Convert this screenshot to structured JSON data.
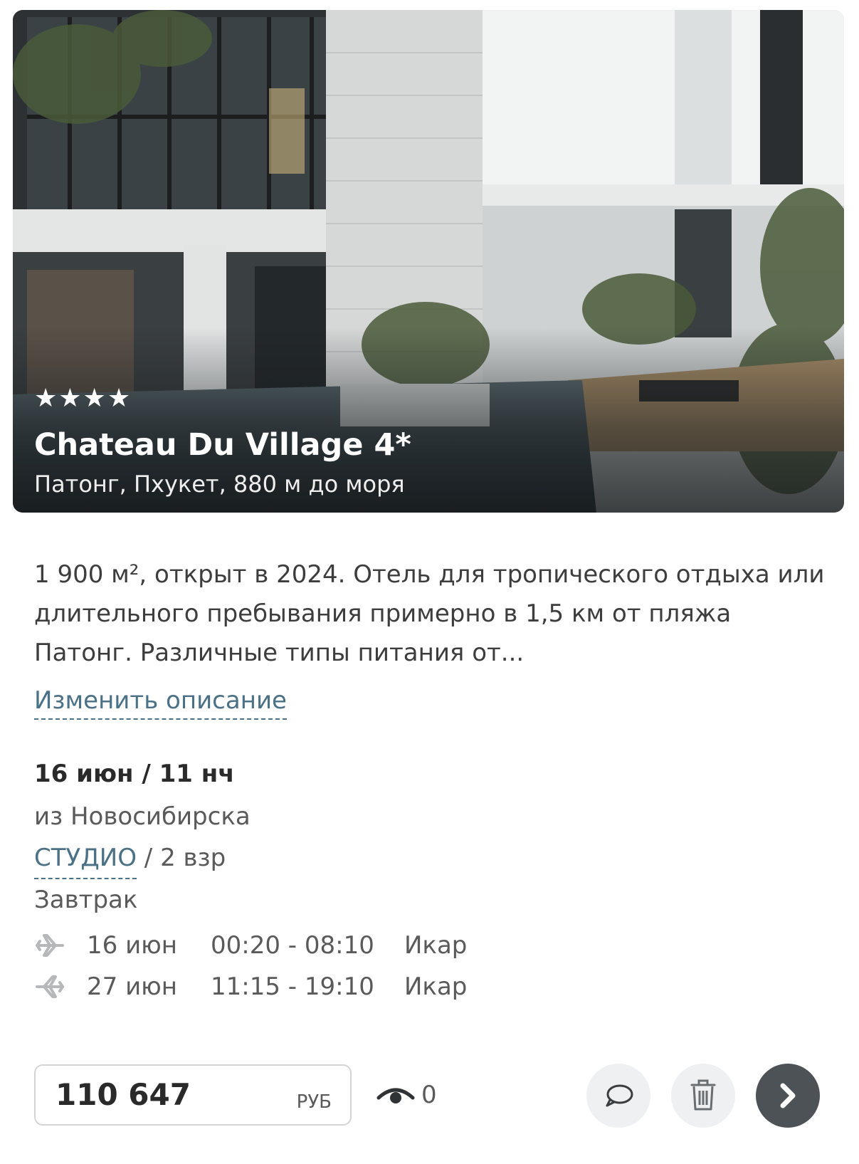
{
  "hotel": {
    "stars": "★★★★",
    "name": "Chateau Du Village 4*",
    "location": "Патонг, Пхукет, 880 м до моря"
  },
  "description": {
    "text": "1 900 м², открыт в 2024. Отель для тропического отдыха или длительного пребывания примерно в 1,5 км от пляжа Патонг. Различные типы питания от...",
    "edit_label": "Изменить описание"
  },
  "tour": {
    "dates": "16 июн / 11 нч",
    "departure_city": "из Новосибирска",
    "room_type": "СТУДИО",
    "guests": " / 2 взр",
    "meal": "Завтрак"
  },
  "flights": [
    {
      "direction": "departure",
      "icon": "plane-departure-icon",
      "date": "16 июн",
      "time": "00:20 - 08:10",
      "airline": "Икар"
    },
    {
      "direction": "return",
      "icon": "plane-return-icon",
      "date": "27 июн",
      "time": "11:15 - 19:10",
      "airline": "Икар"
    }
  ],
  "price": {
    "value": "110 647",
    "currency": "РУБ"
  },
  "views": {
    "icon": "eye-icon",
    "count": "0"
  },
  "actions": {
    "comment_icon": "comment-icon",
    "delete_icon": "trash-icon",
    "next_icon": "chevron-right-icon"
  },
  "colors": {
    "link": "#4a7186",
    "dark_button": "#4d5256",
    "light_button": "#eef0f1"
  }
}
